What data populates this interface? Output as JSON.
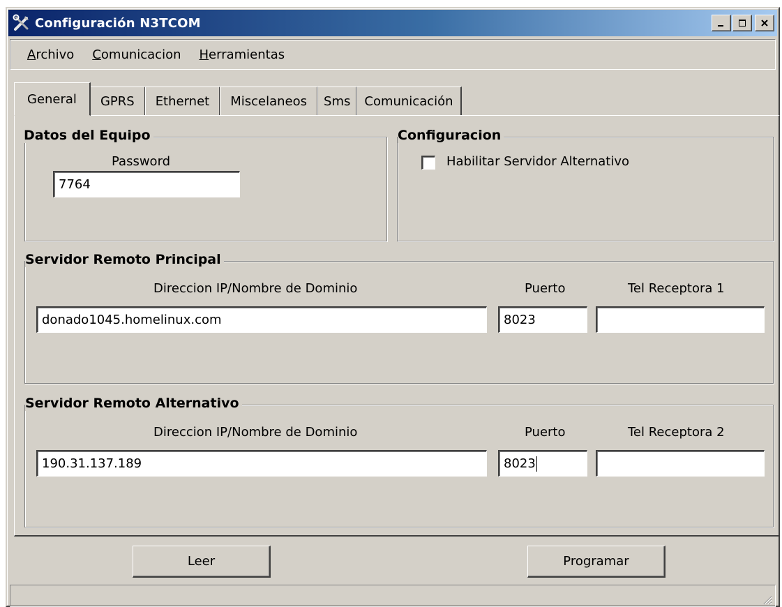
{
  "window": {
    "title": "Configuración N3TCOM",
    "icon": "tools-icon",
    "controls": [
      "minimize-icon",
      "maximize-icon",
      "close-icon"
    ]
  },
  "menu": {
    "items": [
      {
        "label": "Archivo",
        "accel": "A",
        "rest": "rchivo"
      },
      {
        "label": "Comunicacion",
        "accel": "C",
        "rest": "omunicacion"
      },
      {
        "label": "Herramientas",
        "accel": "H",
        "rest": "erramientas"
      }
    ]
  },
  "tabs": [
    {
      "label": "General",
      "active": true
    },
    {
      "label": "GPRS",
      "active": false
    },
    {
      "label": "Ethernet",
      "active": false
    },
    {
      "label": "Miscelaneos",
      "active": false
    },
    {
      "label": "Sms",
      "active": false
    },
    {
      "label": "Comunicación",
      "active": false
    }
  ],
  "datos_equipo": {
    "title": "Datos del Equipo",
    "password_label": "Password",
    "password_value": "7764"
  },
  "configuracion": {
    "title": "Configuracion",
    "checkbox_label": "Habilitar Servidor Alternativo",
    "checked": false
  },
  "servidor_principal": {
    "title": "Servidor Remoto Principal",
    "ip_label": "Direccion IP/Nombre de Dominio",
    "ip_value": "donado1045.homelinux.com",
    "port_label": "Puerto",
    "port_value": "8023",
    "tel_label": "Tel Receptora 1",
    "tel_value": ""
  },
  "servidor_alternativo": {
    "title": "Servidor Remoto Alternativo",
    "ip_label": "Direccion IP/Nombre de Dominio",
    "ip_value": "190.31.137.189",
    "port_label": "Puerto",
    "port_value": "8023",
    "tel_label": "Tel Receptora 2",
    "tel_value": ""
  },
  "buttons": {
    "leer": "Leer",
    "programar": "Programar"
  },
  "colors": {
    "face": "#d4d0c8",
    "title_start": "#0a246a",
    "title_end": "#a6caf0"
  }
}
